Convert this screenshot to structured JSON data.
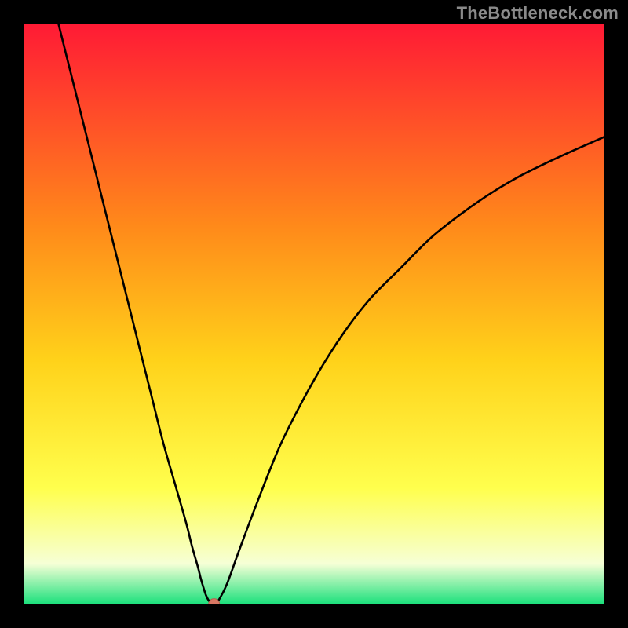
{
  "watermark": "TheBottleneck.com",
  "colors": {
    "frame": "#000000",
    "grad_top": "#ff1a35",
    "grad_mid1": "#ff8a1a",
    "grad_mid2": "#ffd21a",
    "grad_mid3": "#ffff4d",
    "grad_mid4": "#f6ffd6",
    "grad_bot": "#19e07b",
    "curve": "#000000",
    "marker_fill": "#d97763",
    "marker_stroke": "#b85e4c"
  },
  "chart_data": {
    "type": "line",
    "title": "",
    "xlabel": "",
    "ylabel": "",
    "xlim": [
      0,
      100
    ],
    "ylim": [
      0,
      100
    ],
    "x": [
      6,
      8,
      10,
      12,
      14,
      16,
      18,
      20,
      22,
      24,
      26,
      28,
      29,
      30,
      30.5,
      31,
      31.4,
      31.8,
      32.2,
      32.8,
      33.5,
      35,
      37,
      40,
      44,
      48,
      52,
      56,
      60,
      65,
      70,
      75,
      80,
      85,
      90,
      95,
      100
    ],
    "values": [
      100,
      92,
      84,
      76,
      68,
      60,
      52,
      44,
      36,
      28,
      21,
      14,
      10,
      6.5,
      4.5,
      2.8,
      1.6,
      0.8,
      0.3,
      0.05,
      0.6,
      3.5,
      9,
      17,
      27,
      35,
      42,
      48,
      53,
      58,
      63,
      67,
      70.5,
      73.5,
      76,
      78.3,
      80.5
    ],
    "marker": {
      "x": 32.8,
      "y": 0.05
    },
    "grid": false,
    "legend": false
  }
}
